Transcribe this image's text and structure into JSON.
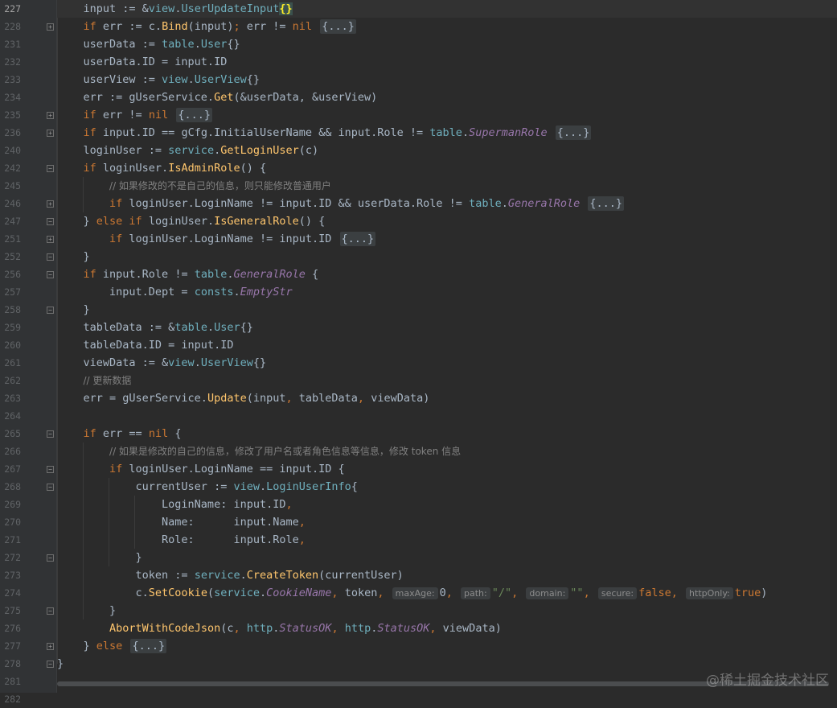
{
  "editor": {
    "line_numbers": [
      "227",
      "228",
      "231",
      "232",
      "233",
      "234",
      "235",
      "236",
      "240",
      "242",
      "245",
      "246",
      "247",
      "251",
      "252",
      "256",
      "257",
      "258",
      "259",
      "260",
      "261",
      "262",
      "263",
      "264",
      "265",
      "266",
      "267",
      "268",
      "269",
      "270",
      "271",
      "272",
      "273",
      "274",
      "275",
      "276",
      "277",
      "278",
      "281",
      "282"
    ],
    "current_line": "227",
    "fold_placeholder": "{...}",
    "hints": {
      "maxAge": "maxAge:",
      "path": "path:",
      "domain": "domain:",
      "secure": "secure:",
      "httpOnly": "httpOnly:"
    },
    "comments": {
      "c246": "// 如果修改的不是自己的信息，则只能修改普通用户",
      "c263": "// 更新数据",
      "c267": "// 如果是修改的自己的信息，修改了用户名或者角色信息等信息，修改 token 信息"
    }
  },
  "watermark": "@稀土掘金技术社区",
  "colors": {
    "background": "#2b2b2b",
    "gutter": "#313335",
    "keyword": "#cc7832",
    "function": "#ffc66d",
    "type": "#6fafbd",
    "constant": "#9876aa",
    "string": "#6a8759",
    "comment": "#808080"
  }
}
